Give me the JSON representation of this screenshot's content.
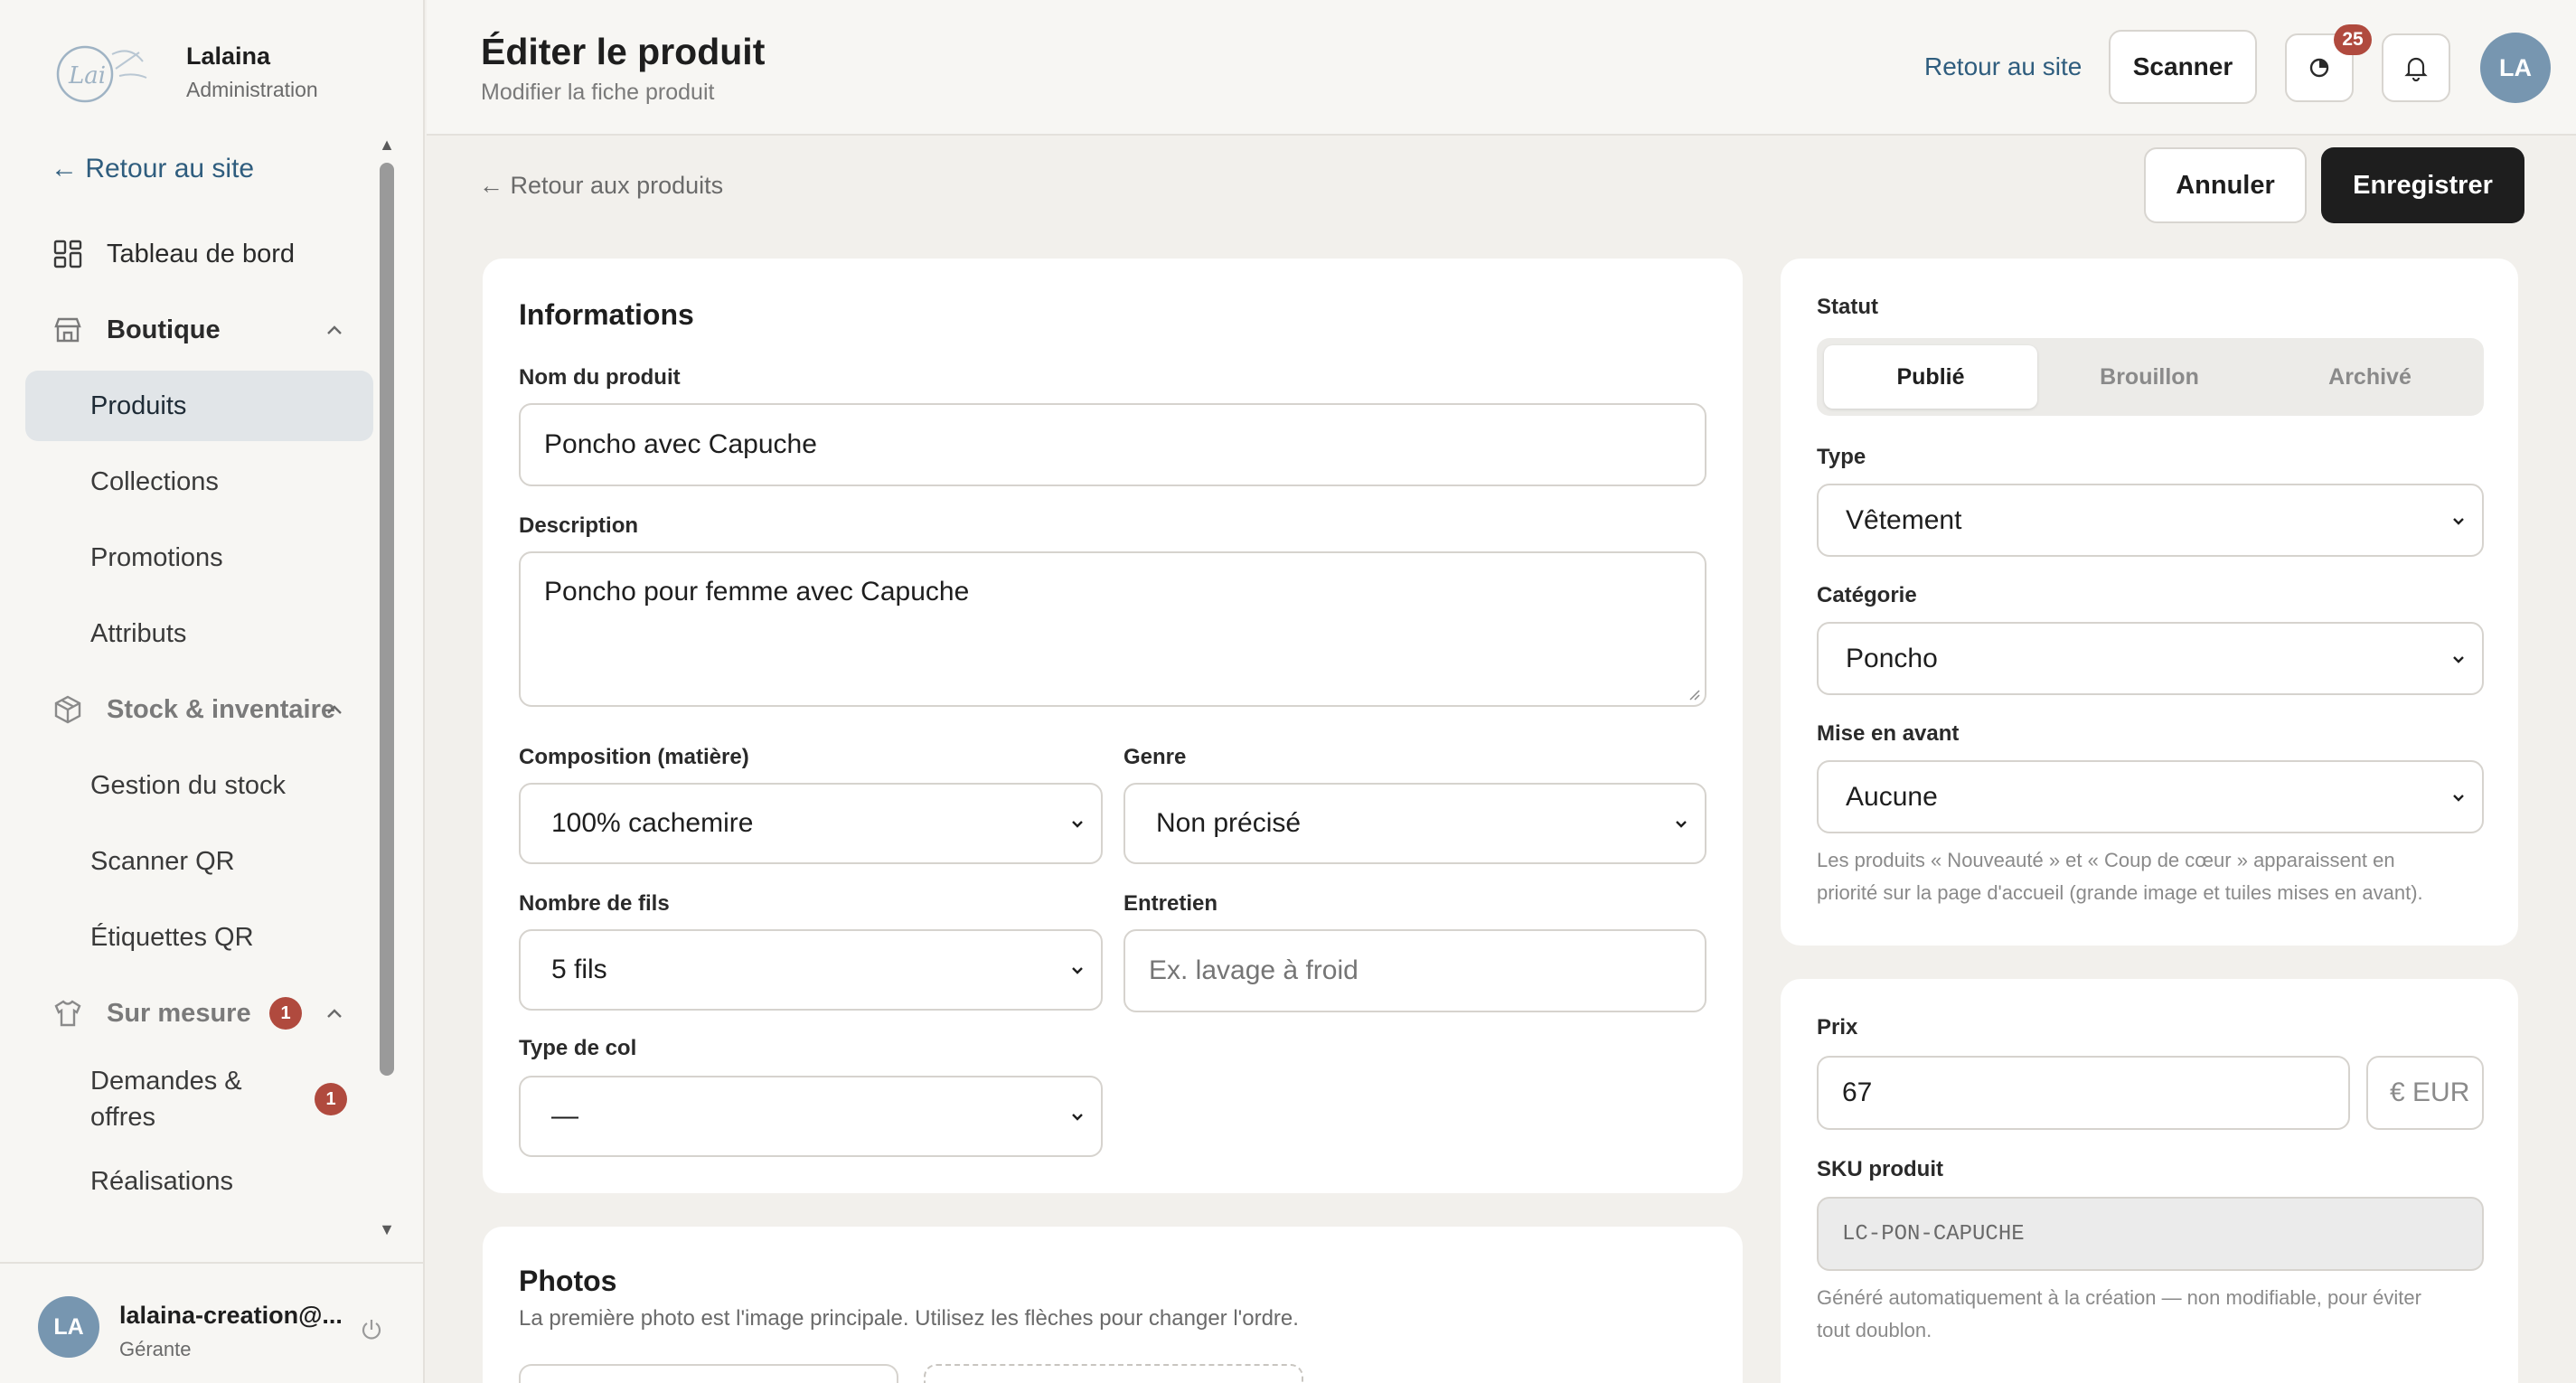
{
  "brand": {
    "logo_text": "Lai",
    "name": "Lalaina",
    "subtitle": "Administration"
  },
  "sidebar": {
    "back_link": "← Retour au site",
    "items": [
      {
        "label": "Tableau de bord",
        "icon": "grid-icon"
      },
      {
        "label": "Boutique",
        "icon": "store-icon"
      },
      {
        "label": "Produits"
      },
      {
        "label": "Collections"
      },
      {
        "label": "Promotions"
      },
      {
        "label": "Attributs"
      },
      {
        "label": "Stock & inventaire",
        "icon": "box-icon"
      },
      {
        "label": "Gestion du stock"
      },
      {
        "label": "Scanner QR"
      },
      {
        "label": "Étiquettes QR"
      },
      {
        "label": "Sur mesure",
        "icon": "shirt-icon",
        "badge": "1"
      },
      {
        "label": "Demandes & offres",
        "badge": "1"
      },
      {
        "label": "Réalisations"
      }
    ],
    "user": {
      "initials": "LA",
      "email": "lalaina-creation@...",
      "role": "Gérante"
    }
  },
  "header": {
    "title": "Éditer le produit",
    "subtitle": "Modifier la fiche produit",
    "site_link": "Retour au site",
    "scanner_label": "Scanner",
    "activity_badge": "25",
    "avatar_initials": "LA"
  },
  "toolbar": {
    "back_link": "← Retour aux produits",
    "cancel_label": "Annuler",
    "save_label": "Enregistrer"
  },
  "info_card": {
    "title": "Informations",
    "name_label": "Nom du produit",
    "name_value": "Poncho avec Capuche",
    "description_label": "Description",
    "description_value": "Poncho pour femme avec Capuche",
    "composition_label": "Composition (matière)",
    "composition_value": "100% cachemire",
    "gender_label": "Genre",
    "gender_value": "Non précisé",
    "threads_label": "Nombre de fils",
    "threads_value": "5 fils",
    "care_label": "Entretien",
    "care_placeholder": "Ex. lavage à froid",
    "collar_label": "Type de col",
    "collar_value": "—"
  },
  "photos_card": {
    "title": "Photos",
    "hint": "La première photo est l'image principale. Utilisez les flèches pour changer l'ordre."
  },
  "status_card": {
    "status_label": "Statut",
    "status_options": [
      "Publié",
      "Brouillon",
      "Archivé"
    ],
    "type_label": "Type",
    "type_value": "Vêtement",
    "category_label": "Catégorie",
    "category_value": "Poncho",
    "highlight_label": "Mise en avant",
    "highlight_value": "Aucune",
    "highlight_hint_1": "Les produits « Nouveauté » et « Coup de cœur » apparaissent en",
    "highlight_hint_2": "priorité sur la page d'accueil (grande image et tuiles mises en avant)."
  },
  "price_card": {
    "price_label": "Prix",
    "price_value": "67",
    "currency": "€ EUR",
    "sku_label": "SKU produit",
    "sku_value": "LC-PON-CAPUCHE",
    "sku_hint_1": "Généré automatiquement à la création — non modifiable, pour éviter",
    "sku_hint_2": "tout doublon."
  }
}
